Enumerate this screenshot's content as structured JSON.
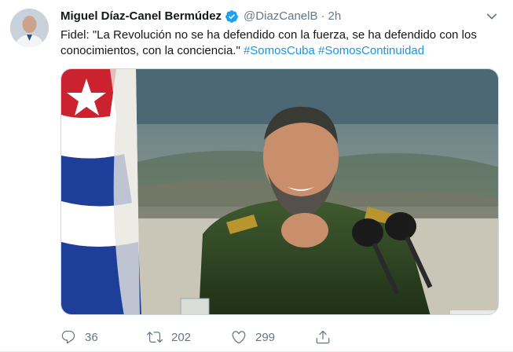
{
  "tweet": {
    "author_name": "Miguel Díaz-Canel Bermúdez",
    "handle": "@DiazCanelB",
    "separator": "·",
    "time": "2h",
    "text_main": "Fidel: \"La Revolución no se ha defendido con la fuerza, se ha defendido con los conocimientos, con la conciencia.\" ",
    "hashtags": [
      "#SomosCuba",
      "#SomosContinuidad"
    ]
  },
  "actions": {
    "replies": "36",
    "retweets": "202",
    "likes": "299"
  },
  "colors": {
    "link": "#1b95e0",
    "muted": "#657786",
    "verified": "#1da1f2"
  },
  "icons": [
    "verified-badge-icon",
    "chevron-down-icon",
    "reply-icon",
    "retweet-icon",
    "like-icon",
    "share-icon"
  ]
}
